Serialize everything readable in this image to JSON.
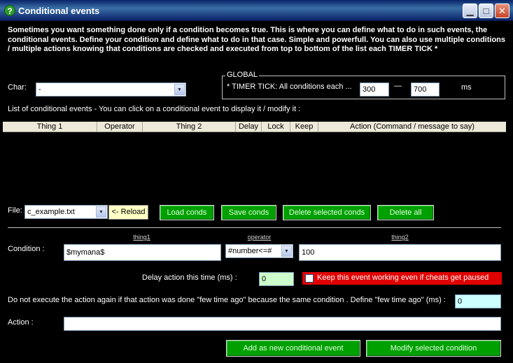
{
  "window": {
    "title": "Conditional events",
    "icon": "?",
    "min_glyph": "▁",
    "max_glyph": "□",
    "close_glyph": "✕"
  },
  "intro_text": "Sometimes you want something done only if a condition becomes true. This is where you can define what to do in such events, the conditional events. Define your condition and define what to do in that case. Simple and powerfull. You can also use multiple conditions / multiple actions knowing that conditions are checked and executed from top to bottom of the list each TIMER TICK *",
  "char": {
    "label": "Char:",
    "value": "-"
  },
  "global": {
    "legend": "GLOBAL",
    "timer_label": "* TIMER TICK: All conditions each ...",
    "min_value": "300",
    "separator": "—",
    "max_value": "700",
    "unit": "ms"
  },
  "list": {
    "caption": "List of conditional events - You can click on a conditional event to display it / modify it :",
    "columns": [
      "Thing 1",
      "Operator",
      "Thing 2",
      "Delay",
      "Lock",
      "Keep",
      "Action (Command / message to say)"
    ]
  },
  "file": {
    "label": "File:",
    "value": "c_example.txt",
    "reload_label": "<- Reload",
    "load_label": "Load conds",
    "save_label": "Save conds",
    "delete_selected_label": "Delete selected conds",
    "delete_all_label": "Delete all"
  },
  "condition": {
    "label": "Condition :",
    "thing1_header": "thing1",
    "operator_header": "operator",
    "thing2_header": "thing2",
    "thing1_value": "$mymana$",
    "operator_value": "#number<=#",
    "thing2_value": "100"
  },
  "delay": {
    "label": "Delay action this time (ms) :",
    "value": "0"
  },
  "keep": {
    "label": "Keep this event working even if cheats get paused",
    "checked": false
  },
  "few_time": {
    "label": "Do not execute the action again if that action was done \"few time ago\" because the same condition . Define \"few time ago\" (ms) :",
    "value": "0"
  },
  "action": {
    "label": "Action :",
    "value": ""
  },
  "buttons": {
    "add_label": "Add as new conditional event",
    "modify_label": "Modify selected condition"
  },
  "colors": {
    "background": "#000000",
    "button_green": "#00a000",
    "keep_red": "#e00000",
    "titlebar": "#0a246a"
  }
}
